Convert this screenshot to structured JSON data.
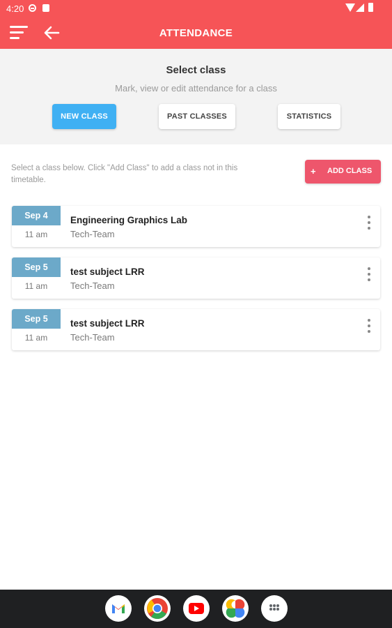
{
  "status_bar": {
    "time": "4:20"
  },
  "app_bar": {
    "title": "ATTENDANCE"
  },
  "select_section": {
    "title": "Select class",
    "subtitle": "Mark, view or edit attendance for a class",
    "new_class_label": "NEW CLASS",
    "past_classes_label": "PAST CLASSES",
    "statistics_label": "STATISTICS"
  },
  "hint_text": "Select a class below. Click \"Add Class\" to add a class not in this timetable.",
  "add_class": {
    "plus": "+",
    "label": "ADD CLASS"
  },
  "classes": [
    {
      "date": "Sep 4",
      "time": "11 am",
      "title": "Engineering Graphics Lab",
      "subtitle": "Tech-Team"
    },
    {
      "date": "Sep 5",
      "time": "11 am",
      "title": "test subject LRR",
      "subtitle": "Tech-Team"
    },
    {
      "date": "Sep 5",
      "time": "11 am",
      "title": "test subject LRR",
      "subtitle": "Tech-Team"
    }
  ],
  "dock": [
    "gmail-icon",
    "chrome-icon",
    "youtube-icon",
    "photos-icon",
    "app-drawer-icon"
  ],
  "colors": {
    "primary": "#f65457",
    "new_class_button": "#3fb0f3",
    "add_class_button": "#ee566c",
    "date_badge": "#6ca9c9",
    "nav_bar": "#1f2022"
  }
}
